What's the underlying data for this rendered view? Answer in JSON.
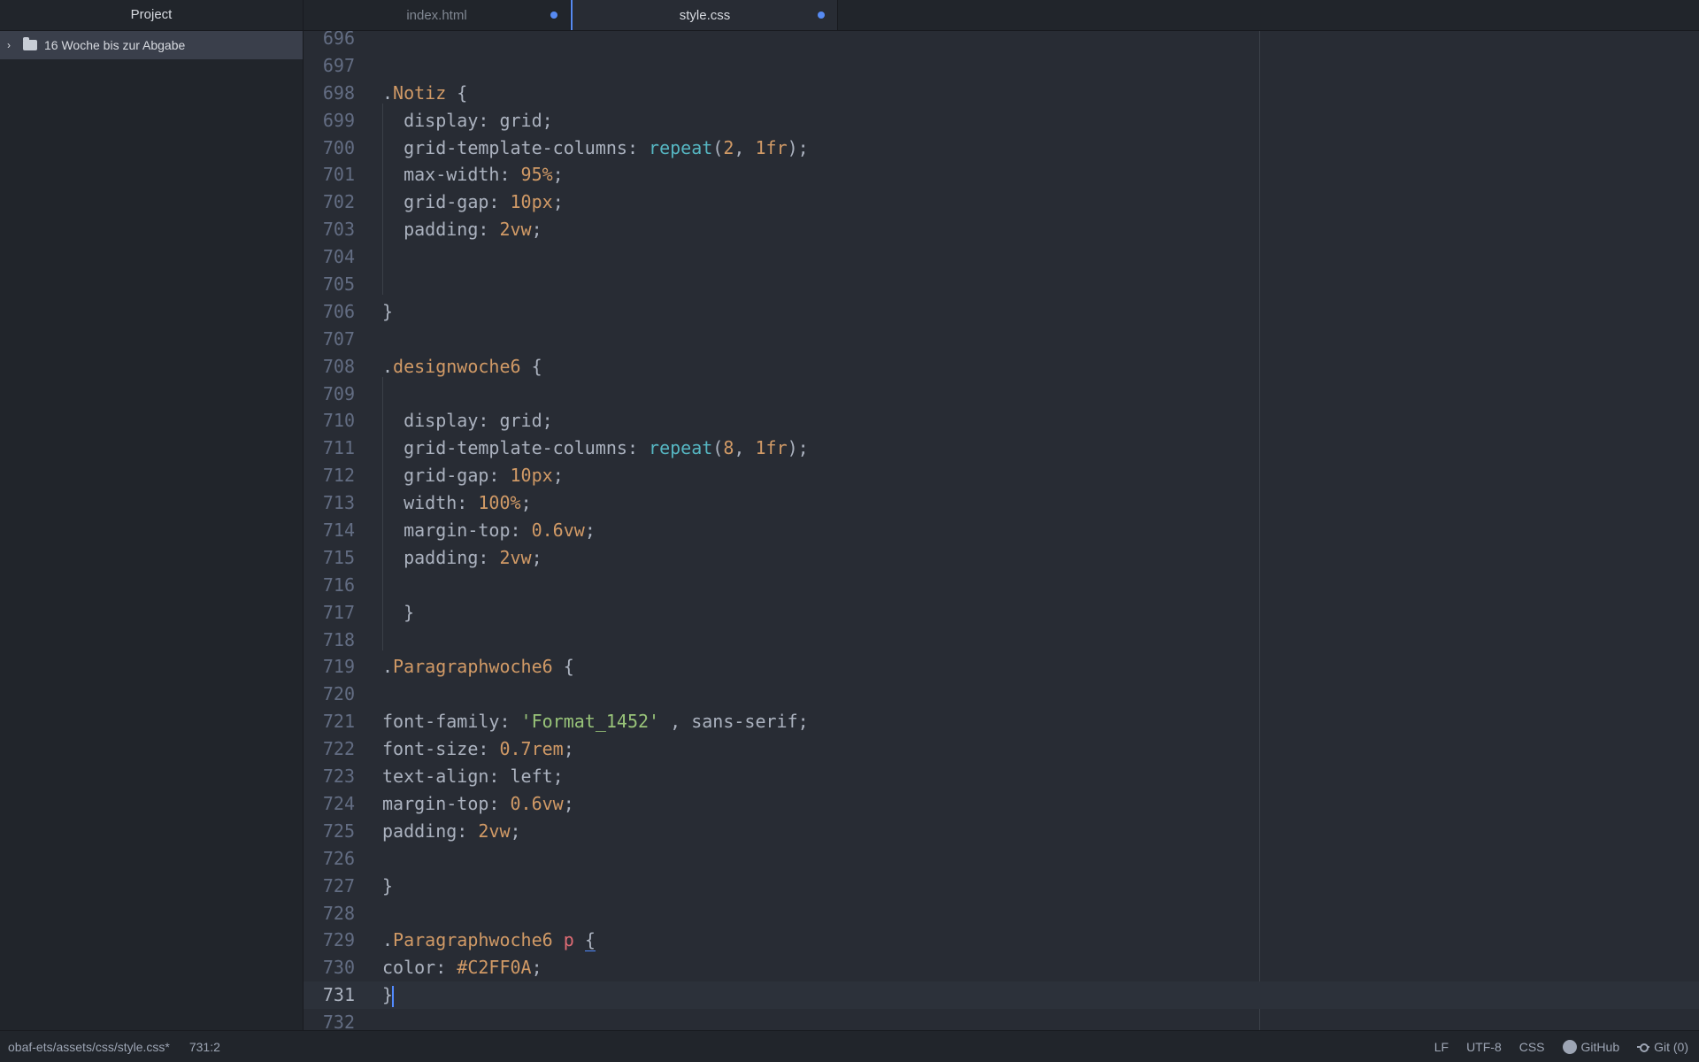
{
  "sidebar": {
    "title": "Project",
    "items": [
      {
        "label": "16 Woche bis zur Abgabe",
        "icon": "folder-icon",
        "expander": "chevron-right-icon"
      }
    ]
  },
  "tabs": [
    {
      "label": "index.html",
      "modified": true,
      "active": false
    },
    {
      "label": "style.css",
      "modified": true,
      "active": true
    }
  ],
  "editor": {
    "language": "CSS",
    "cursor_line": 731,
    "lines": [
      {
        "n": "696",
        "tokens": []
      },
      {
        "n": "697",
        "tokens": []
      },
      {
        "n": "698",
        "tokens": [
          [
            "p",
            "."
          ],
          [
            "sel",
            "Notiz"
          ],
          [
            "p",
            " {"
          ]
        ]
      },
      {
        "n": "699",
        "indent": true,
        "tokens": [
          [
            "p",
            "display: grid;"
          ]
        ]
      },
      {
        "n": "700",
        "indent": true,
        "tokens": [
          [
            "p",
            "grid-template-columns: "
          ],
          [
            "fn",
            "repeat"
          ],
          [
            "p",
            "("
          ],
          [
            "num",
            "2"
          ],
          [
            "p",
            ", "
          ],
          [
            "num",
            "1fr"
          ],
          [
            "p",
            ");"
          ]
        ]
      },
      {
        "n": "701",
        "indent": true,
        "tokens": [
          [
            "p",
            "max-width: "
          ],
          [
            "num",
            "95%"
          ],
          [
            "p",
            ";"
          ]
        ]
      },
      {
        "n": "702",
        "indent": true,
        "tokens": [
          [
            "p",
            "grid-gap: "
          ],
          [
            "num",
            "10px"
          ],
          [
            "p",
            ";"
          ]
        ]
      },
      {
        "n": "703",
        "indent": true,
        "tokens": [
          [
            "p",
            "padding: "
          ],
          [
            "num",
            "2vw"
          ],
          [
            "p",
            ";"
          ]
        ]
      },
      {
        "n": "704",
        "indent": true,
        "tokens": []
      },
      {
        "n": "705",
        "indent": true,
        "tokens": []
      },
      {
        "n": "706",
        "tokens": [
          [
            "p",
            "}"
          ]
        ]
      },
      {
        "n": "707",
        "tokens": []
      },
      {
        "n": "708",
        "tokens": [
          [
            "p",
            "."
          ],
          [
            "sel",
            "designwoche6"
          ],
          [
            "p",
            " {"
          ]
        ]
      },
      {
        "n": "709",
        "indent": true,
        "tokens": []
      },
      {
        "n": "710",
        "indent": true,
        "tokens": [
          [
            "p",
            "display: grid;"
          ]
        ]
      },
      {
        "n": "711",
        "indent": true,
        "tokens": [
          [
            "p",
            "grid-template-columns: "
          ],
          [
            "fn",
            "repeat"
          ],
          [
            "p",
            "("
          ],
          [
            "num",
            "8"
          ],
          [
            "p",
            ", "
          ],
          [
            "num",
            "1fr"
          ],
          [
            "p",
            ");"
          ]
        ]
      },
      {
        "n": "712",
        "indent": true,
        "tokens": [
          [
            "p",
            "grid-gap: "
          ],
          [
            "num",
            "10px"
          ],
          [
            "p",
            ";"
          ]
        ]
      },
      {
        "n": "713",
        "indent": true,
        "tokens": [
          [
            "p",
            "width: "
          ],
          [
            "num",
            "100%"
          ],
          [
            "p",
            ";"
          ]
        ]
      },
      {
        "n": "714",
        "indent": true,
        "tokens": [
          [
            "p",
            "margin-top: "
          ],
          [
            "num",
            "0.6vw"
          ],
          [
            "p",
            ";"
          ]
        ]
      },
      {
        "n": "715",
        "indent": true,
        "tokens": [
          [
            "p",
            "padding: "
          ],
          [
            "num",
            "2vw"
          ],
          [
            "p",
            ";"
          ]
        ]
      },
      {
        "n": "716",
        "indent": true,
        "tokens": []
      },
      {
        "n": "717",
        "indent": true,
        "tokens": [
          [
            "p",
            "}"
          ]
        ]
      },
      {
        "n": "718",
        "indent": true,
        "tokens": []
      },
      {
        "n": "719",
        "tokens": [
          [
            "p",
            "."
          ],
          [
            "sel",
            "Paragraphwoche6"
          ],
          [
            "p",
            " {"
          ]
        ]
      },
      {
        "n": "720",
        "tokens": []
      },
      {
        "n": "721",
        "tokens": [
          [
            "p",
            "font-family: "
          ],
          [
            "str",
            "'Format_1452'"
          ],
          [
            "p",
            " , sans-serif;"
          ]
        ]
      },
      {
        "n": "722",
        "tokens": [
          [
            "p",
            "font-size: "
          ],
          [
            "num",
            "0.7rem"
          ],
          [
            "p",
            ";"
          ]
        ]
      },
      {
        "n": "723",
        "tokens": [
          [
            "p",
            "text-align: left;"
          ]
        ]
      },
      {
        "n": "724",
        "tokens": [
          [
            "p",
            "margin-top: "
          ],
          [
            "num",
            "0.6vw"
          ],
          [
            "p",
            ";"
          ]
        ]
      },
      {
        "n": "725",
        "tokens": [
          [
            "p",
            "padding: "
          ],
          [
            "num",
            "2vw"
          ],
          [
            "p",
            ";"
          ]
        ]
      },
      {
        "n": "726",
        "tokens": []
      },
      {
        "n": "727",
        "tokens": [
          [
            "p",
            "}"
          ]
        ]
      },
      {
        "n": "728",
        "tokens": []
      },
      {
        "n": "729",
        "tokens": [
          [
            "p",
            "."
          ],
          [
            "sel",
            "Paragraphwoche6"
          ],
          [
            "p",
            " "
          ],
          [
            "tag",
            "p"
          ],
          [
            "p",
            " "
          ],
          [
            "bm",
            "{"
          ]
        ]
      },
      {
        "n": "730",
        "tokens": [
          [
            "p",
            "color: "
          ],
          [
            "num",
            "#"
          ],
          [
            "num",
            "C2FF0A"
          ],
          [
            "p",
            ";"
          ]
        ]
      },
      {
        "n": "731",
        "tokens": [
          [
            "p",
            "}"
          ],
          [
            "caret",
            ""
          ]
        ]
      },
      {
        "n": "732",
        "tokens": []
      }
    ]
  },
  "statusbar": {
    "file_path": "obaf-ets/assets/css/style.css*",
    "cursor_position": "731:2",
    "line_ending": "LF",
    "encoding": "UTF-8",
    "grammar": "CSS",
    "github_label": "GitHub",
    "git_label": "Git (0)"
  },
  "colors": {
    "accent": "#568af2",
    "background": "#282c34",
    "panel": "#21252b",
    "selector": "#d19a66",
    "number": "#d19a66",
    "function": "#56b6c2",
    "string": "#98c379",
    "tag": "#e06c75"
  }
}
